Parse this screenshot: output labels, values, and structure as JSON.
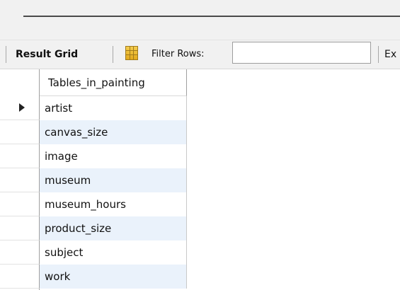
{
  "toolbar": {
    "result_grid_label": "Result Grid",
    "filter_rows_label": "Filter Rows:",
    "filter_value": "",
    "truncated_label": "Ex"
  },
  "grid": {
    "column_header": "Tables_in_painting",
    "rows": [
      "artist",
      "canvas_size",
      "image",
      "museum",
      "museum_hours",
      "product_size",
      "subject",
      "work"
    ],
    "selected_row": 0
  },
  "icons": {
    "result_grid_icon": "grid-icon",
    "current_row_marker": "triangle-right-icon"
  },
  "colors": {
    "alt_row": "#eaf2fb",
    "toolbar_bg": "#f1f1f1",
    "grid_icon": "#f0c040"
  }
}
